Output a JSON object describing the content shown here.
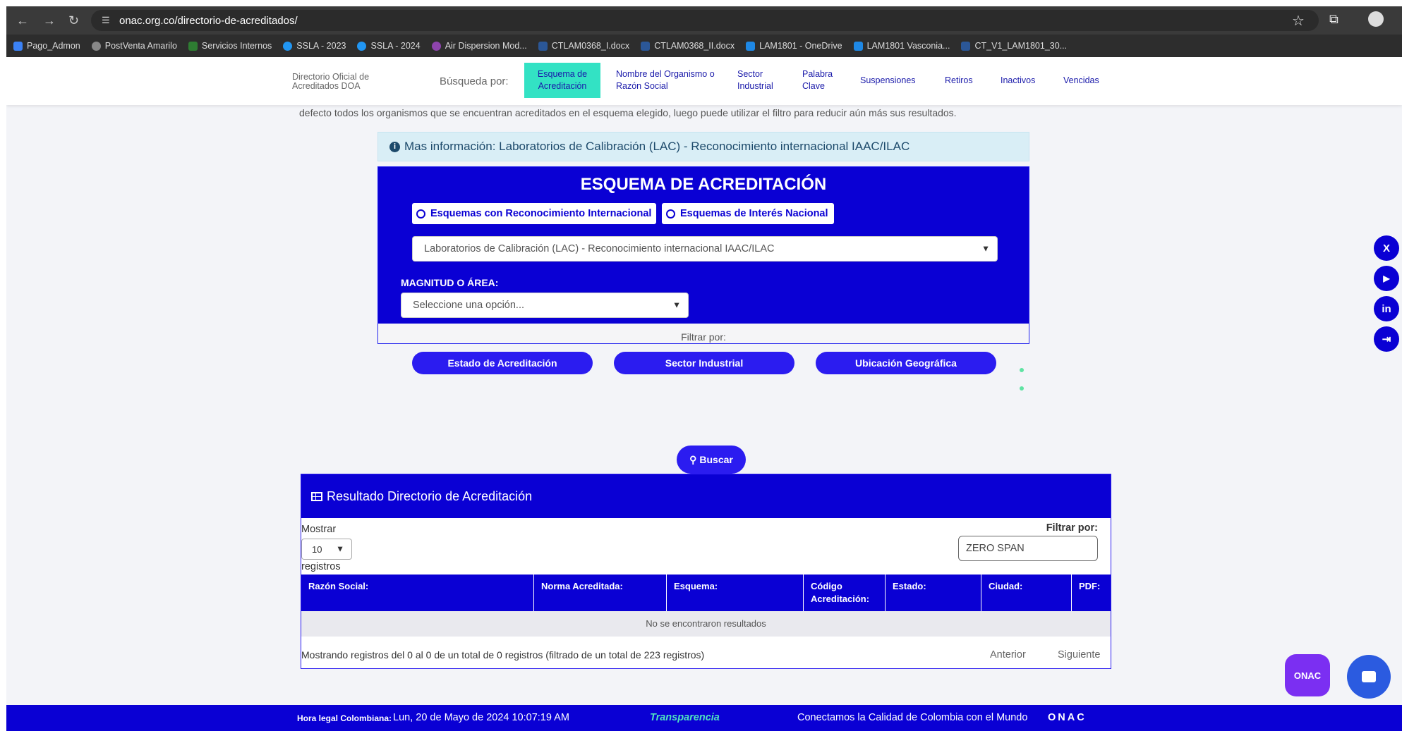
{
  "browser": {
    "url": "onac.org.co/directorio-de-acreditados/",
    "bookmarks": [
      "Pago_Admon",
      "PostVenta Amarilo",
      "Servicios Internos",
      "SSLA - 2023",
      "SSLA - 2024",
      "Air Dispersion Mod...",
      "CTLAM0368_I.docx",
      "CTLAM0368_II.docx",
      "LAM1801 - OneDrive",
      "LAM1801 Vasconia...",
      "CT_V1_LAM1801_30..."
    ]
  },
  "header": {
    "brand": "Directorio Oficial de Acreditados DOA",
    "busqueda_label": "Búsqueda por:",
    "tabs": [
      "Esquema de Acreditación",
      "Nombre del Organismo o Razón Social",
      "Sector Industrial",
      "Palabra Clave",
      "Suspensiones",
      "Retiros",
      "Inactivos",
      "Vencidas"
    ]
  },
  "intro_text": "defecto todos los organismos que se encuentran acreditados en el esquema elegido, luego puede utilizar el filtro para reducir aún más sus resultados.",
  "info": "Mas información: Laboratorios de Calibración (LAC) - Reconocimiento internacional IAAC/ILAC",
  "esquema": {
    "title": "ESQUEMA DE ACREDITACIÓN",
    "radio_intl": "Esquemas con Reconocimiento Internacional",
    "radio_nac": "Esquemas de Interés Nacional",
    "selected_scheme": "Laboratorios de Calibración (LAC) - Reconocimiento internacional IAAC/ILAC",
    "magnitud_label": "MAGNITUD O ÁREA:",
    "magnitud_placeholder": "Seleccione una opción...",
    "filtrar_label": "Filtrar por:",
    "btn_estado": "Estado de Acreditación",
    "btn_sector": "Sector Industrial",
    "btn_ubicacion": "Ubicación Geográfica"
  },
  "buscar": "Buscar",
  "results": {
    "title": "Resultado Directorio de Acreditación",
    "mostrar": "Mostrar",
    "rows_value": "10",
    "registros": "registros",
    "filtrar_por": "Filtrar por:",
    "filter_value": "ZERO SPAN",
    "columns": [
      "Razón Social:",
      "Norma Acreditada:",
      "Esquema:",
      "Código Acreditación:",
      "Estado:",
      "Ciudad:",
      "PDF:"
    ],
    "empty": "No se encontraron resultados",
    "summary": "Mostrando registros del 0 al 0 de un total de 0 registros (filtrado de un total de 223 registros)",
    "prev": "Anterior",
    "next": "Siguiente"
  },
  "footer": {
    "hora_label": "Hora legal Colombiana:",
    "hora_value": "Lun, 20 de Mayo de 2024 10:07:19 AM",
    "transparencia": "Transparencia",
    "slogan": "Conectamos la Calidad de Colombia con el Mundo",
    "logo": "ONAC"
  },
  "social": [
    "X",
    "YouTube",
    "in",
    "login"
  ],
  "onac_badge": "ONAC",
  "colors": {
    "brand_blue": "#0a00d4",
    "button_blue": "#2b1cf0",
    "active_tab": "#33e2c4"
  }
}
